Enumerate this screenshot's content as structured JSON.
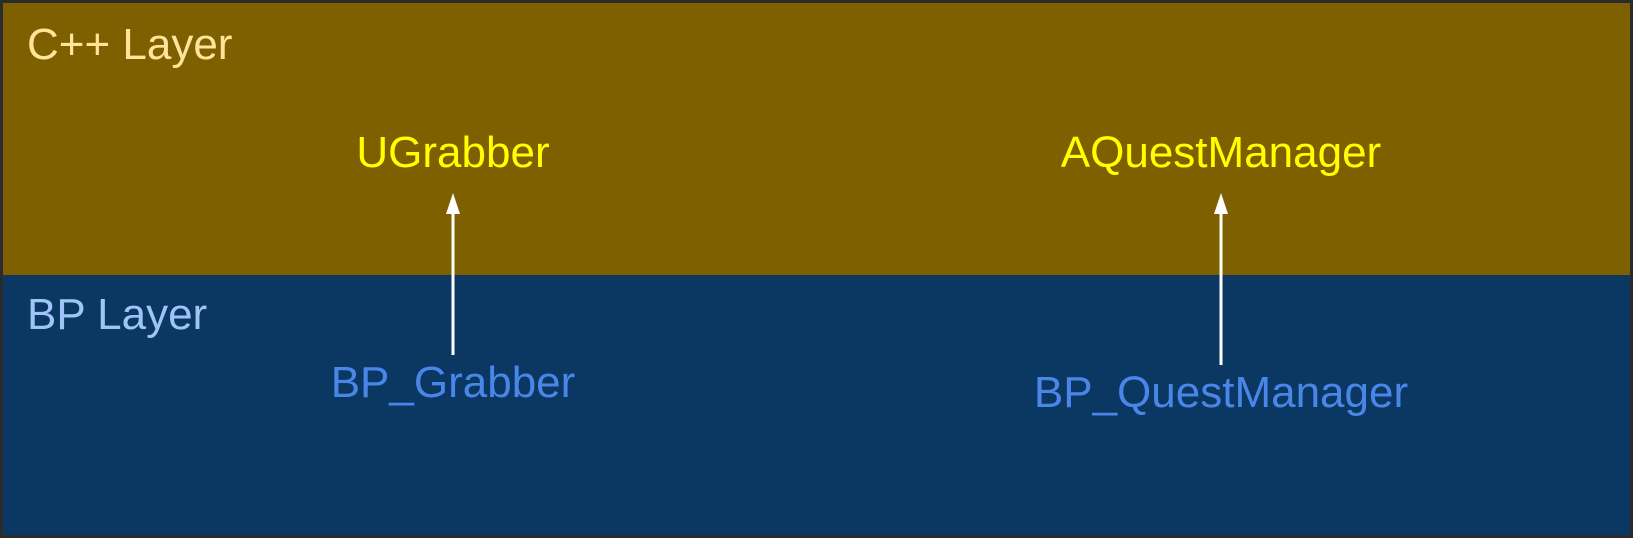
{
  "colors": {
    "cpp_layer_bg": "#7f6000",
    "bp_layer_bg": "#0b3763",
    "cpp_layer_title": "#ffe599",
    "bp_layer_title": "#9fc5f8",
    "cpp_class_text": "#ffff00",
    "bp_class_text": "#4a86e8",
    "arrow": "#ffffff"
  },
  "layers": {
    "cpp": {
      "title": "C++ Layer",
      "classes": [
        "UGrabber",
        "AQuestManager"
      ]
    },
    "bp": {
      "title": "BP Layer",
      "classes": [
        "BP_Grabber",
        "BP_QuestManager"
      ]
    }
  },
  "inheritance": [
    {
      "from": "BP_Grabber",
      "to": "UGrabber"
    },
    {
      "from": "BP_QuestManager",
      "to": "AQuestManager"
    }
  ]
}
